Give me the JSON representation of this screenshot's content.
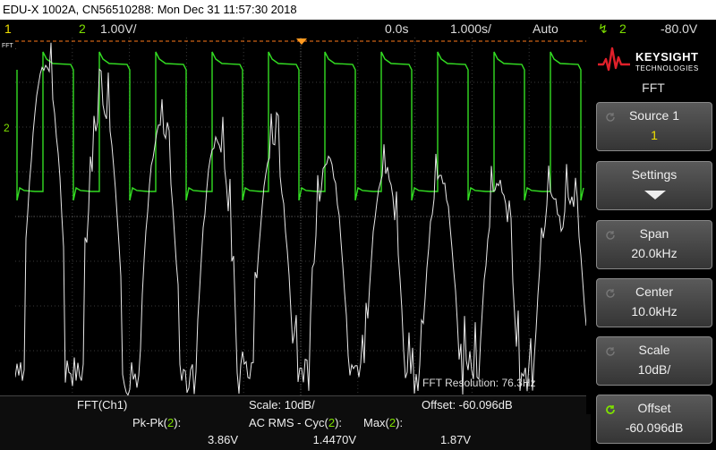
{
  "titlebar": {
    "text": "EDU-X 1002A, CN56510288: Mon Dec 31 11:57:30 2018"
  },
  "status": {
    "ch1": "1",
    "ch2": "2",
    "ch2_scale": "1.00V/",
    "time_delay": "0.0s",
    "time_scale": "1.000s/",
    "trigger_mode": "Auto",
    "trigger_source": "2",
    "trigger_level": "-80.0V"
  },
  "grid_markers": {
    "fft_label": "FFT",
    "ch2_marker": "2"
  },
  "annotation": {
    "fft_resolution": "FFT Resolution: 76.3Hz"
  },
  "sidebar": {
    "brand_name": "KEYSIGHT",
    "brand_sub": "TECHNOLOGIES",
    "menu_title": "FFT",
    "softkeys": [
      {
        "label": "Source 1",
        "value": "1"
      },
      {
        "label": "Settings",
        "value": ""
      },
      {
        "label": "Span",
        "value": "20.0kHz"
      },
      {
        "label": "Center",
        "value": "10.0kHz"
      },
      {
        "label": "Scale",
        "value": "10dB/"
      },
      {
        "label": "Offset",
        "value": "-60.096dB"
      }
    ]
  },
  "bottom_bar": {
    "fft_source": "FFT(Ch1)",
    "scale": "Scale: 10dB/",
    "offset": "Offset: -60.096dB"
  },
  "measurements": [
    {
      "label_prefix": "Pk-Pk(",
      "channel": "2",
      "label_suffix": "):",
      "value": "3.86V"
    },
    {
      "label_prefix": "AC RMS - Cyc(",
      "channel": "2",
      "label_suffix": "):",
      "value": "1.4470V"
    },
    {
      "label_prefix": "Max(",
      "channel": "2",
      "label_suffix": "):",
      "value": "1.87V"
    }
  ],
  "colors": {
    "ch1": "#f0e000",
    "ch2": "#33dd22",
    "fft": "#e8e8e8",
    "math": "#d060c0",
    "brand_red": "#e0202a"
  }
}
